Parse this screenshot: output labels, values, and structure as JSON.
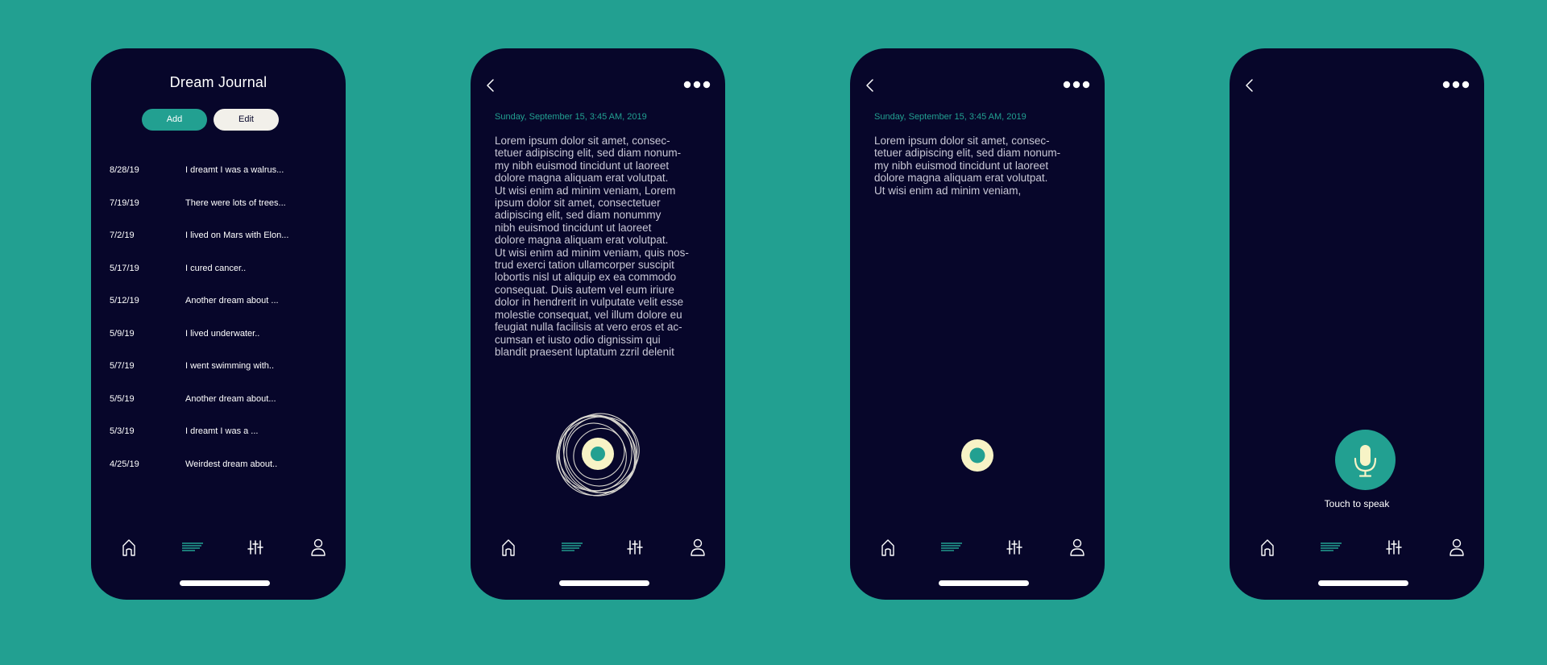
{
  "colors": {
    "background": "#22a091",
    "phone": "#07062a",
    "accent": "#22a091",
    "cream": "#f7f3c6"
  },
  "journal": {
    "title": "Dream Journal",
    "add_label": "Add",
    "edit_label": "Edit",
    "entries": [
      {
        "date": "8/28/19",
        "text": "I dreamt I was a walrus..."
      },
      {
        "date": "7/19/19",
        "text": "There were lots of trees..."
      },
      {
        "date": "7/2/19",
        "text": "I lived on Mars with Elon..."
      },
      {
        "date": "5/17/19",
        "text": "I cured cancer.."
      },
      {
        "date": "5/12/19",
        "text": "Another dream about ..."
      },
      {
        "date": "5/9/19",
        "text": "I lived underwater.."
      },
      {
        "date": "5/7/19",
        "text": "I went swimming with.."
      },
      {
        "date": "5/5/19",
        "text": "Another dream about..."
      },
      {
        "date": "5/3/19",
        "text": "I dreamt I was a ..."
      },
      {
        "date": "4/25/19",
        "text": "Weirdest dream about.."
      }
    ]
  },
  "entry_long": {
    "timestamp": "Sunday, September 15, 3:45 AM, 2019",
    "body": "Lorem ipsum dolor sit amet, consec-\ntetuer adipiscing elit, sed diam nonum-\nmy nibh euismod tincidunt ut laoreet\ndolore magna aliquam erat volutpat.\nUt wisi enim ad minim veniam, Lorem\nipsum dolor sit amet, consectetuer\nadipiscing elit, sed diam nonummy\nnibh euismod tincidunt ut laoreet\ndolore magna aliquam erat volutpat.\nUt wisi enim ad minim veniam, quis nos-\ntrud exerci tation ullamcorper suscipit\nlobortis nisl ut aliquip ex ea commodo\nconsequat. Duis autem vel eum iriure\ndolor in hendrerit in vulputate velit esse\nmolestie consequat, vel illum dolore eu\nfeugiat nulla facilisis at vero eros et ac-\ncumsan et iusto odio dignissim qui\nblandit praesent luptatum zzril delenit"
  },
  "entry_short": {
    "timestamp": "Sunday, September 15, 3:45 AM, 2019",
    "body": "Lorem ipsum dolor sit amet, consec-\ntetuer adipiscing elit, sed diam nonum-\nmy nibh euismod tincidunt ut laoreet\ndolore magna aliquam erat volutpat.\nUt wisi enim ad minim veniam,"
  },
  "speak": {
    "label": "Touch to speak"
  },
  "nav": {
    "items": [
      {
        "icon": "home-icon"
      },
      {
        "icon": "journal-lines-icon"
      },
      {
        "icon": "sliders-icon"
      },
      {
        "icon": "profile-icon"
      }
    ]
  }
}
